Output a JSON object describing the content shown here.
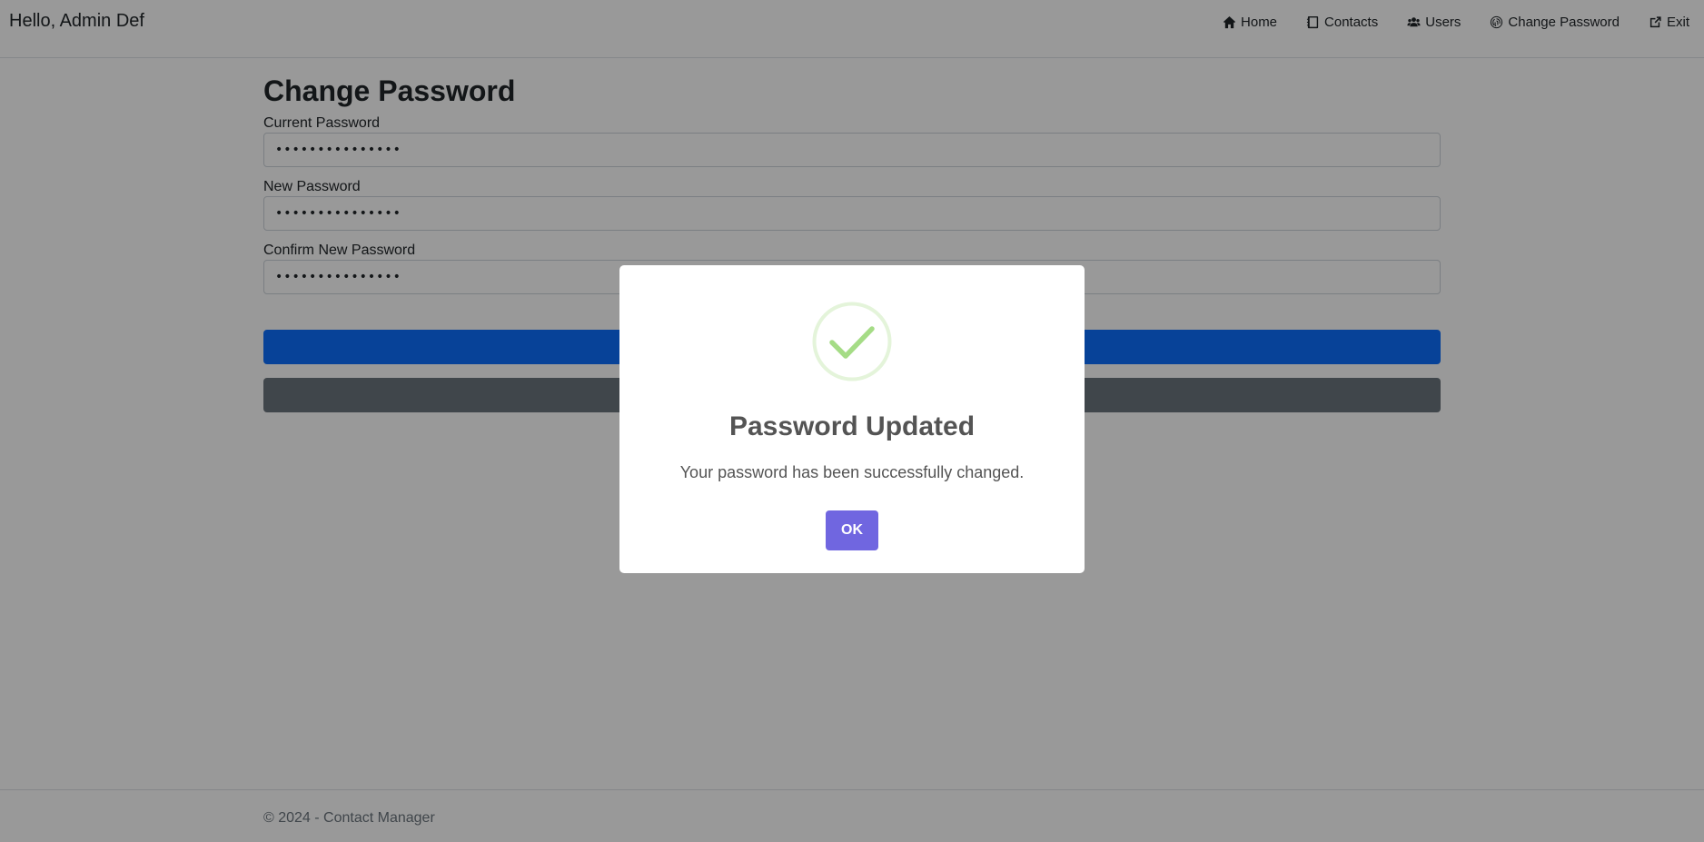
{
  "navbar": {
    "greeting": "Hello, Admin Def",
    "items": [
      {
        "label": "Home",
        "icon": "home-icon"
      },
      {
        "label": "Contacts",
        "icon": "address-book-icon"
      },
      {
        "label": "Users",
        "icon": "users-icon"
      },
      {
        "label": "Change Password",
        "icon": "fingerprint-icon"
      },
      {
        "label": "Exit",
        "icon": "external-link-icon"
      }
    ]
  },
  "form": {
    "title": "Change Password",
    "current_password": {
      "label": "Current Password",
      "value": "•••••••••••••••"
    },
    "new_password": {
      "label": "New Password",
      "value": "•••••••••••••••"
    },
    "confirm_password": {
      "label": "Confirm New Password",
      "value": "•••••••••••••••"
    },
    "primary_button_color": "#0d6efd",
    "secondary_button_color": "#6c757d"
  },
  "footer": {
    "text": "© 2024 - Contact Manager"
  },
  "modal": {
    "icon": "success-check-icon",
    "title": "Password Updated",
    "message": "Your password has been successfully changed.",
    "ok_label": "OK",
    "ok_color": "#7066e0",
    "success_color": "#a5dc86"
  }
}
